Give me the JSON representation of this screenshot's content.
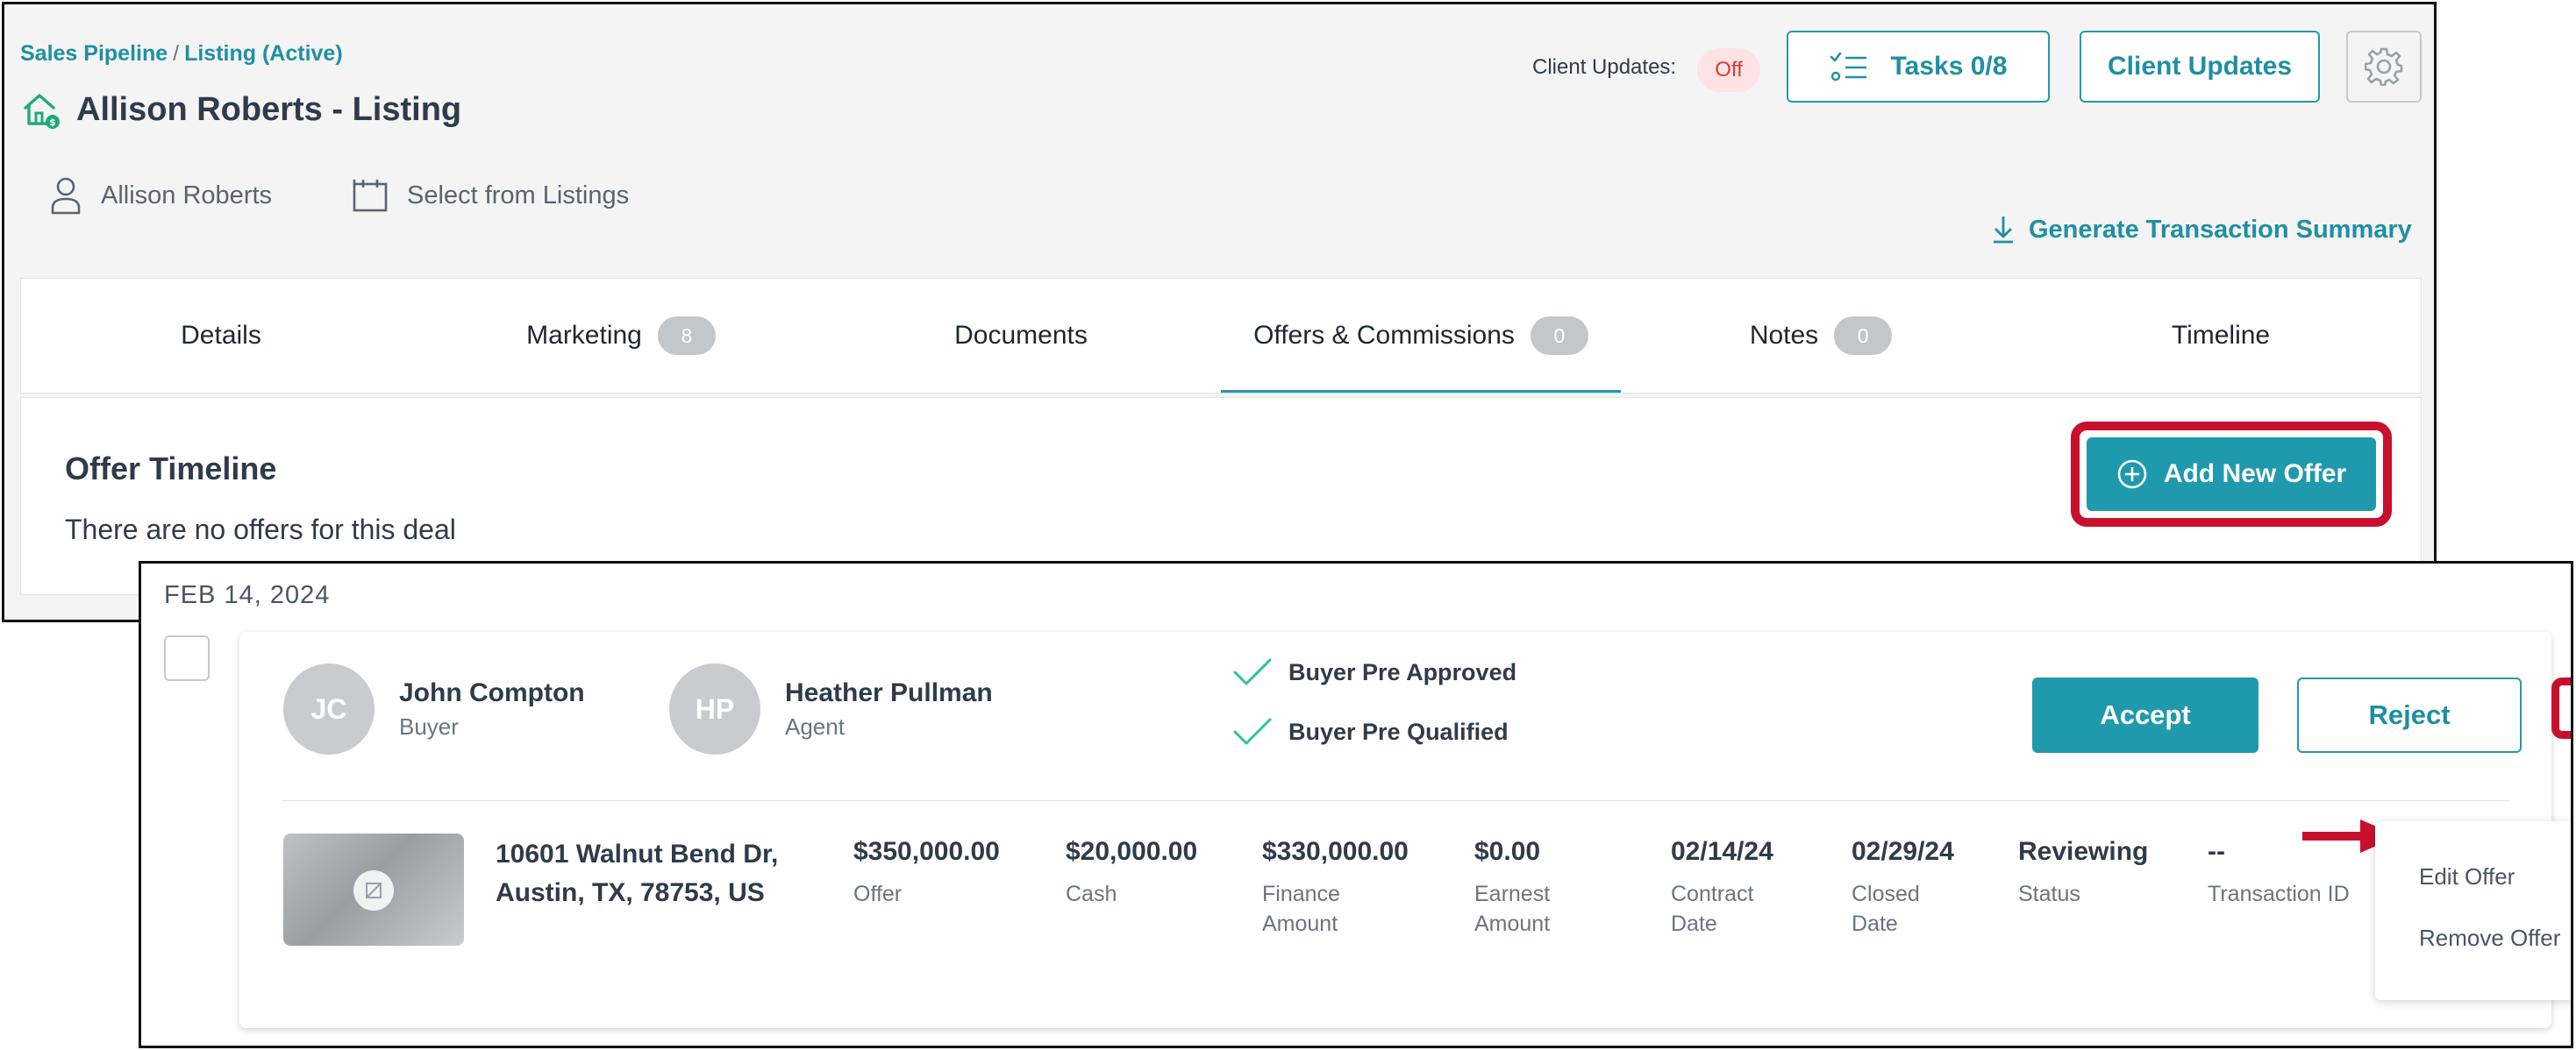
{
  "breadcrumb": {
    "item1": "Sales Pipeline",
    "separator": "/",
    "item2": "Listing (Active)"
  },
  "page_title": "Allison Roberts - Listing",
  "meta": {
    "contact": "Allison Roberts",
    "listing_select": "Select from Listings"
  },
  "header": {
    "client_updates_label": "Client Updates:",
    "client_updates_status": "Off",
    "tasks_label": "Tasks 0/8",
    "client_updates_button": "Client Updates",
    "generate_summary": "Generate Transaction Summary"
  },
  "tabs": [
    {
      "label": "Details"
    },
    {
      "label": "Marketing",
      "count": "8"
    },
    {
      "label": "Documents"
    },
    {
      "label": "Offers & Commissions",
      "count": "0"
    },
    {
      "label": "Notes",
      "count": "0"
    },
    {
      "label": "Timeline"
    }
  ],
  "active_tab": "Offers & Commissions",
  "offer_timeline": {
    "title": "Offer Timeline",
    "empty_message": "There are no offers for this deal",
    "add_button": "Add New Offer"
  },
  "offer": {
    "date": "FEB 14, 2024",
    "buyer": {
      "initials": "JC",
      "name": "John Compton",
      "role": "Buyer"
    },
    "agent": {
      "initials": "HP",
      "name": "Heather Pullman",
      "role": "Agent"
    },
    "checks": [
      "Buyer Pre Approved",
      "Buyer Pre Qualified"
    ],
    "accept": "Accept",
    "reject": "Reject",
    "address_line1": "10601 Walnut Bend Dr,",
    "address_line2": "Austin, TX, 78753, US",
    "stats": [
      {
        "value": "$350,000.00",
        "label1": "Offer",
        "label2": ""
      },
      {
        "value": "$20,000.00",
        "label1": "Cash",
        "label2": ""
      },
      {
        "value": "$330,000.00",
        "label1": "Finance",
        "label2": "Amount"
      },
      {
        "value": "$0.00",
        "label1": "Earnest",
        "label2": "Amount"
      },
      {
        "value": "02/14/24",
        "label1": "Contract",
        "label2": "Date"
      },
      {
        "value": "02/29/24",
        "label1": "Closed",
        "label2": "Date"
      },
      {
        "value": "Reviewing",
        "label1": "Status",
        "label2": ""
      },
      {
        "value": "--",
        "label1": "Transaction ID",
        "label2": ""
      }
    ],
    "menu": [
      "Edit Offer",
      "Remove Offer"
    ]
  },
  "colors": {
    "accent": "#1f9aac",
    "highlight": "#c8102e",
    "off_badge_bg": "#fde3e3",
    "off_badge_text": "#d43c3c"
  }
}
